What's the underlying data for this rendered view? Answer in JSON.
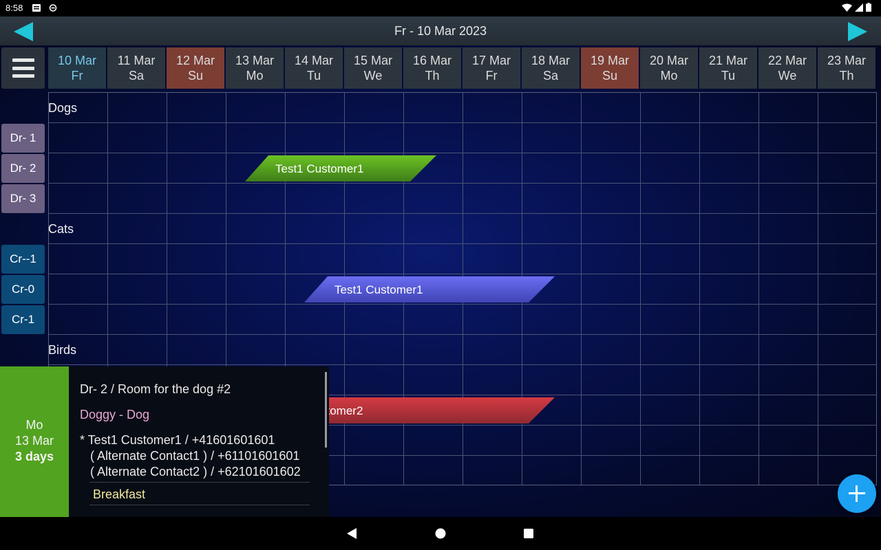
{
  "status": {
    "time": "8:58"
  },
  "header": {
    "title": "Fr - 10 Mar 2023"
  },
  "days": [
    {
      "date": "10 Mar",
      "dow": "Fr"
    },
    {
      "date": "11 Mar",
      "dow": "Sa"
    },
    {
      "date": "12 Mar",
      "dow": "Su"
    },
    {
      "date": "13 Mar",
      "dow": "Mo"
    },
    {
      "date": "14 Mar",
      "dow": "Tu"
    },
    {
      "date": "15 Mar",
      "dow": "We"
    },
    {
      "date": "16 Mar",
      "dow": "Th"
    },
    {
      "date": "17 Mar",
      "dow": "Fr"
    },
    {
      "date": "18 Mar",
      "dow": "Sa"
    },
    {
      "date": "19 Mar",
      "dow": "Su"
    },
    {
      "date": "20 Mar",
      "dow": "Mo"
    },
    {
      "date": "21 Mar",
      "dow": "Tu"
    },
    {
      "date": "22 Mar",
      "dow": "We"
    },
    {
      "date": "23 Mar",
      "dow": "Th"
    }
  ],
  "sections": {
    "dogs": "Dogs",
    "cats": "Cats",
    "birds": "Birds"
  },
  "rooms": {
    "dr1": "Dr- 1",
    "dr2": "Dr- 2",
    "dr3": "Dr- 3",
    "crm1": "Cr--1",
    "cr0": "Cr-0",
    "cr1": "Cr-1"
  },
  "bookings": {
    "green": {
      "label": "Test1 Customer1",
      "color": "#4f9a1c"
    },
    "blue": {
      "label": "Test1 Customer1",
      "color": "#5257d8"
    },
    "red": {
      "label": "stomer2",
      "color": "#c0343b"
    }
  },
  "popup": {
    "weekday": "Mo",
    "date": "13 Mar",
    "duration": "3 days",
    "room_line": "Dr- 2  /  Room for the dog #2",
    "pet": "Doggy - Dog",
    "contact1": "*  Test1 Customer1 / +41601601601",
    "contact2": "( Alternate Contact1 ) / +61101601601",
    "contact3": "( Alternate Contact2 ) / +62101601602",
    "meal": "Breakfast"
  },
  "colors": {
    "selected_day_text": "#79c7e8",
    "weekend_bg": "#7c3d33",
    "fab": "#1da1f2",
    "arrow": "#1ec6d8"
  }
}
